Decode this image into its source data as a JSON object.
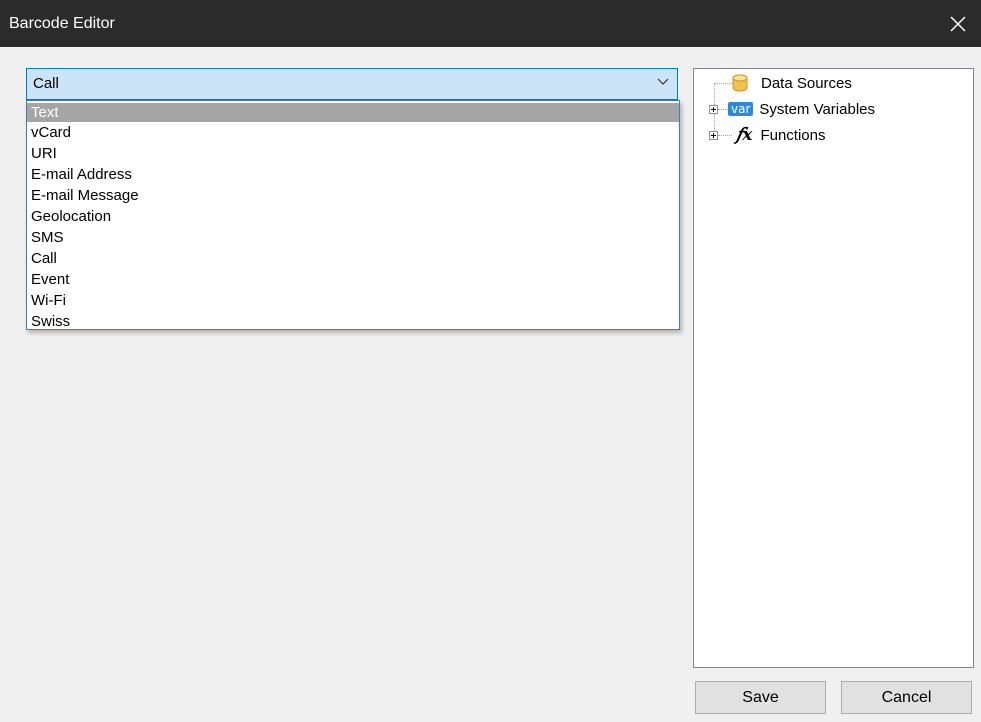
{
  "window": {
    "title": "Barcode Editor"
  },
  "combo": {
    "selected": "Call",
    "options": [
      "Text",
      "vCard",
      "URI",
      "E-mail Address",
      "E-mail Message",
      "Geolocation",
      "SMS",
      "Call",
      "Event",
      "Wi-Fi",
      "Swiss"
    ],
    "highlighted_option": "Text"
  },
  "tree": {
    "items": [
      {
        "label": "Data Sources",
        "icon": "database-icon",
        "expandable": false
      },
      {
        "label": "System Variables",
        "icon": "var-icon",
        "icon_text": "var",
        "expandable": true
      },
      {
        "label": "Functions",
        "icon": "function-icon",
        "icon_text": "fx",
        "expandable": true
      }
    ]
  },
  "buttons": {
    "save": "Save",
    "cancel": "Cancel"
  },
  "colors": {
    "titlebar": "#2b2b2b",
    "combo_fill": "#cce4f7",
    "combo_border": "#0078d7",
    "highlight": "#a5a5a5",
    "var_badge": "#2e8ad8"
  }
}
